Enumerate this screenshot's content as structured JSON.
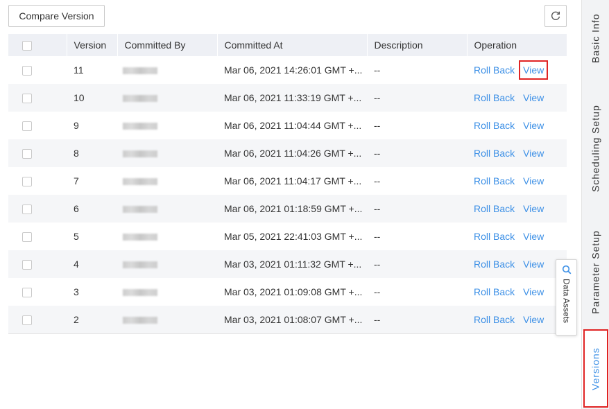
{
  "toolbar": {
    "compare_label": "Compare Version",
    "refresh_icon": "refresh-icon"
  },
  "table": {
    "headers": [
      "Version",
      "Committed By",
      "Committed At",
      "Description",
      "Operation"
    ],
    "rows": [
      {
        "version": "11",
        "committed_at": "Mar 06, 2021 14:26:01 GMT +...",
        "description": "--"
      },
      {
        "version": "10",
        "committed_at": "Mar 06, 2021 11:33:19 GMT +...",
        "description": "--"
      },
      {
        "version": "9",
        "committed_at": "Mar 06, 2021 11:04:44 GMT +...",
        "description": "--"
      },
      {
        "version": "8",
        "committed_at": "Mar 06, 2021 11:04:26 GMT +...",
        "description": "--"
      },
      {
        "version": "7",
        "committed_at": "Mar 06, 2021 11:04:17 GMT +...",
        "description": "--"
      },
      {
        "version": "6",
        "committed_at": "Mar 06, 2021 01:18:59 GMT +...",
        "description": "--"
      },
      {
        "version": "5",
        "committed_at": "Mar 05, 2021 22:41:03 GMT +...",
        "description": "--"
      },
      {
        "version": "4",
        "committed_at": "Mar 03, 2021 01:11:32 GMT +...",
        "description": "--"
      },
      {
        "version": "3",
        "committed_at": "Mar 03, 2021 01:09:08 GMT +...",
        "description": "--"
      },
      {
        "version": "2",
        "committed_at": "Mar 03, 2021 01:08:07 GMT +...",
        "description": "--"
      }
    ],
    "roll_back_label": "Roll Back",
    "view_label": "View"
  },
  "sidebar": {
    "tabs": [
      "Basic Info",
      "Scheduling Setup",
      "Parameter Setup",
      "Versions"
    ],
    "active_tab": "Versions"
  },
  "floating": {
    "data_assets_label": "Data Assets"
  },
  "colors": {
    "accent": "#3b8fe6",
    "highlight": "#e02323",
    "header_bg": "#eef0f5",
    "stripe_bg": "#f5f6f8"
  }
}
